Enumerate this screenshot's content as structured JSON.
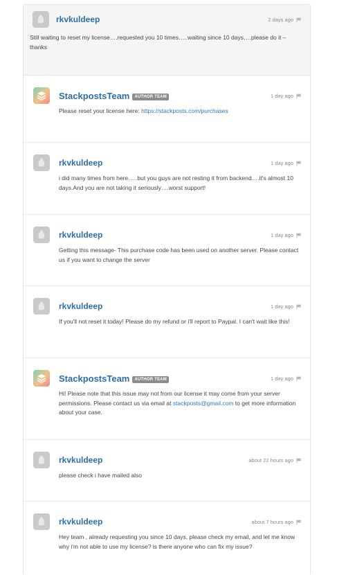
{
  "thread": {
    "first": {
      "author": "rkvkuldeep",
      "time": "2 days ago",
      "text": "Still waiting to reset my license….requested you 10 times…..waiting since 10 days….please do it – thanks"
    },
    "replies": [
      {
        "author": "StackpostsTeam",
        "badge": "AUTHOR TEAM",
        "time": "1 day ago",
        "text_before": "Please reset your license here: ",
        "link": "https://stackposts.com/purchases",
        "text_after": ""
      },
      {
        "author": "rkvkuldeep",
        "time": "1 day ago",
        "text": "i did many times from here…..but you guys are not resting it from backend….it's almost 10 days.And you are not taking it seriously….worst support!"
      },
      {
        "author": "rkvkuldeep",
        "time": "1 day ago",
        "text": "Getting this message- This purchase code has been used on another server. Please contact us if you want to change the server"
      },
      {
        "author": "rkvkuldeep",
        "time": "1 day ago",
        "text": "If you'll not reset it today! Please do my refund or i'll report to Paypal. I can't wait like this!"
      },
      {
        "author": "StackpostsTeam",
        "badge": "AUTHOR TEAM",
        "time": "1 day ago",
        "text_before": "Hi! Please note that this issue may not from our license it may come from your server permissions. Please contact us via email at ",
        "link": "stackposts@gmail.com",
        "text_after": " to get more information about your case."
      },
      {
        "author": "rkvkuldeep",
        "time": "about 22 hours ago",
        "text": "please check i have mailed also"
      },
      {
        "author": "rkvkuldeep",
        "time": "about 7 hours ago",
        "text": "Hey team , already requesting you since 10 days, please check my email, and let me know why i'm not able to use my license? is there anyone who can fix my issue?"
      }
    ]
  },
  "icons": {
    "user_avatar": "default-user-avatar-icon",
    "team_avatar": "stackposts-logo-icon",
    "flag": "flag-icon"
  },
  "colors": {
    "author_link": "#2a6fa8",
    "body_link": "#2a7ab8",
    "badge_bg": "#8c8c8c",
    "first_post_bg": "#f5f5f5"
  }
}
